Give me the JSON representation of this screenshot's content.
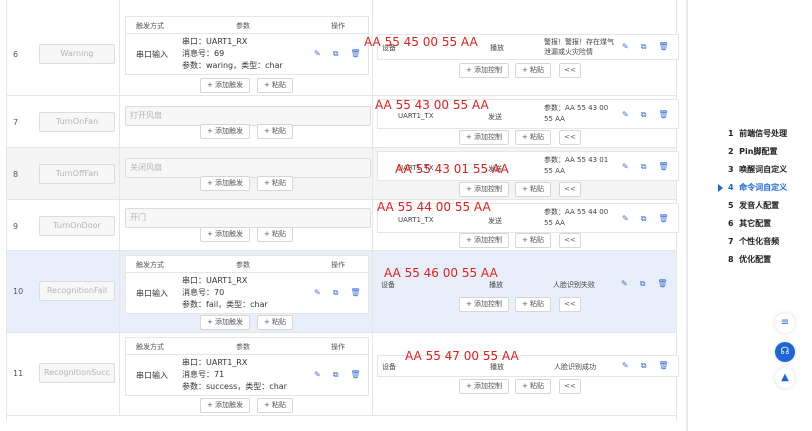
{
  "trigger_headers": {
    "mode": "触发方式",
    "params": "参数",
    "ops": "操作"
  },
  "output_headers": {
    "device": "设备",
    "action": "播放"
  },
  "buttons": {
    "add_trigger": "+ 添加触发",
    "paste": "+ 粘贴",
    "add_control": "+ 添加控制",
    "collapse": "<<"
  },
  "rows": [
    {
      "index": "6",
      "keyword": "Warning",
      "trigger_mode": "串口输入",
      "port": "串口：UART1_RX",
      "msg": "消息号：69",
      "param": "参数：waring，类型：char",
      "device": "设备",
      "action": "播放",
      "result": "警报！警报！存在煤气泄漏或火灾险情",
      "overlay": "AA 55 45 00 55 AA"
    },
    {
      "index": "7",
      "keyword": "TurnOnFan",
      "placeholder": "打开风扇",
      "device": "UART1_TX",
      "action": "发送",
      "result": "参数：AA 55 43 00 55 AA",
      "overlay": "AA 55 43 00 55 AA"
    },
    {
      "index": "8",
      "keyword": "TurnOffFan",
      "placeholder": "关闭风扇",
      "device": "UART1_TX",
      "action": "发送",
      "result": "参数：AA 55 43 01 55 AA",
      "overlay": "AA 55 43 01 55 AA"
    },
    {
      "index": "9",
      "keyword": "TurnOnDoor",
      "placeholder": "开门",
      "device": "UART1_TX",
      "action": "发送",
      "result": "参数：AA 55 44 00 55 AA",
      "overlay": "AA 55 44 00 55 AA"
    },
    {
      "index": "10",
      "keyword": "RecognitionFail",
      "trigger_mode": "串口输入",
      "port": "串口：UART1_RX",
      "msg": "消息号：70",
      "param": "参数：fail，类型：char",
      "device": "设备",
      "action": "播放",
      "result": "人脸识别失败",
      "overlay": "AA 55 46 00 55 AA"
    },
    {
      "index": "11",
      "keyword": "RecognitionSucc",
      "trigger_mode": "串口输入",
      "port": "串口：UART1_RX",
      "msg": "消息号：71",
      "param": "参数：success，类型：char",
      "device": "设备",
      "action": "播放",
      "result": "人脸识别成功",
      "overlay": "AA 55 47 00 55 AA"
    }
  ],
  "sidebar": [
    {
      "num": "1",
      "label": "前端信号处理"
    },
    {
      "num": "2",
      "label": "Pin脚配置"
    },
    {
      "num": "3",
      "label": "唤醒词自定义"
    },
    {
      "num": "4",
      "label": "命令词自定义"
    },
    {
      "num": "5",
      "label": "发音人配置"
    },
    {
      "num": "6",
      "label": "其它配置"
    },
    {
      "num": "7",
      "label": "个性化音频"
    },
    {
      "num": "8",
      "label": "优化配置"
    }
  ],
  "colors": {
    "accent": "#1e66d6",
    "overlay": "#e0201c",
    "row_highlight": "#e8effb"
  }
}
